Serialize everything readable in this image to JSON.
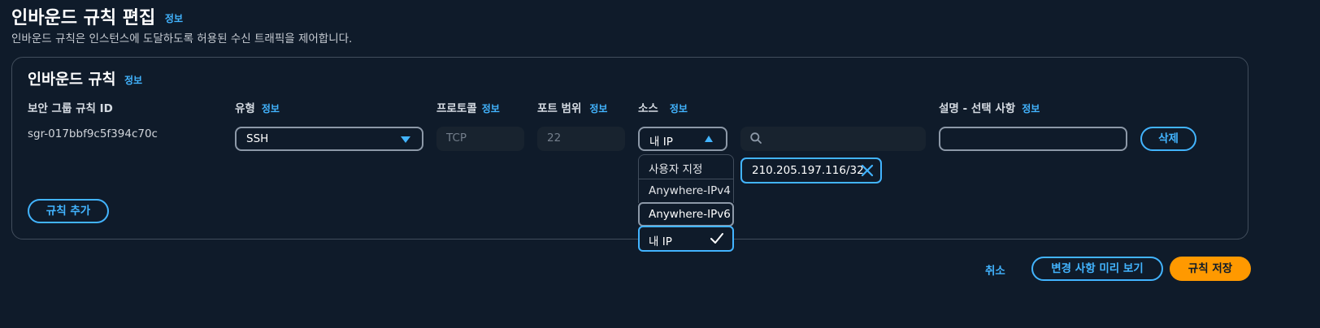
{
  "header": {
    "title": "인바운드 규칙 편집",
    "info_link": "정보",
    "description": "인바운드 규칙은 인스턴스에 도달하도록 허용된 수신 트래픽을 제어합니다."
  },
  "panel": {
    "title": "인바운드 규칙",
    "info_link": "정보",
    "columns": {
      "rule_id": "보안 그룹 규칙 ID",
      "type": "유형",
      "protocol": "프로토콜",
      "port_range": "포트 범위",
      "source": "소스",
      "description": "설명 - 선택 사항"
    },
    "info_label": "정보",
    "row": {
      "rule_id": "sgr-017bbf9c5f394c70c",
      "type_value": "SSH",
      "protocol_value": "TCP",
      "port_value": "22",
      "source_value": "내 IP",
      "cidr_search_placeholder": "",
      "description_value": "",
      "delete_label": "삭제",
      "cidr_token": "210.205.197.116/32"
    },
    "source_options": [
      {
        "label": "사용자 지정"
      },
      {
        "label": "Anywhere-IPv4"
      },
      {
        "label": "Anywhere-IPv6"
      },
      {
        "label": "내 IP",
        "selected": true
      }
    ],
    "add_rule_label": "규칙 추가"
  },
  "footer": {
    "cancel_label": "취소",
    "preview_label": "변경 사항 미리 보기",
    "save_label": "규칙 저장"
  },
  "colors": {
    "background": "#0f1b2a",
    "accent": "#42b4ff",
    "primary_button": "#ff9900"
  },
  "icons": [
    "search-icon",
    "check-icon",
    "close-icon",
    "caret-down-icon",
    "caret-up-icon"
  ]
}
